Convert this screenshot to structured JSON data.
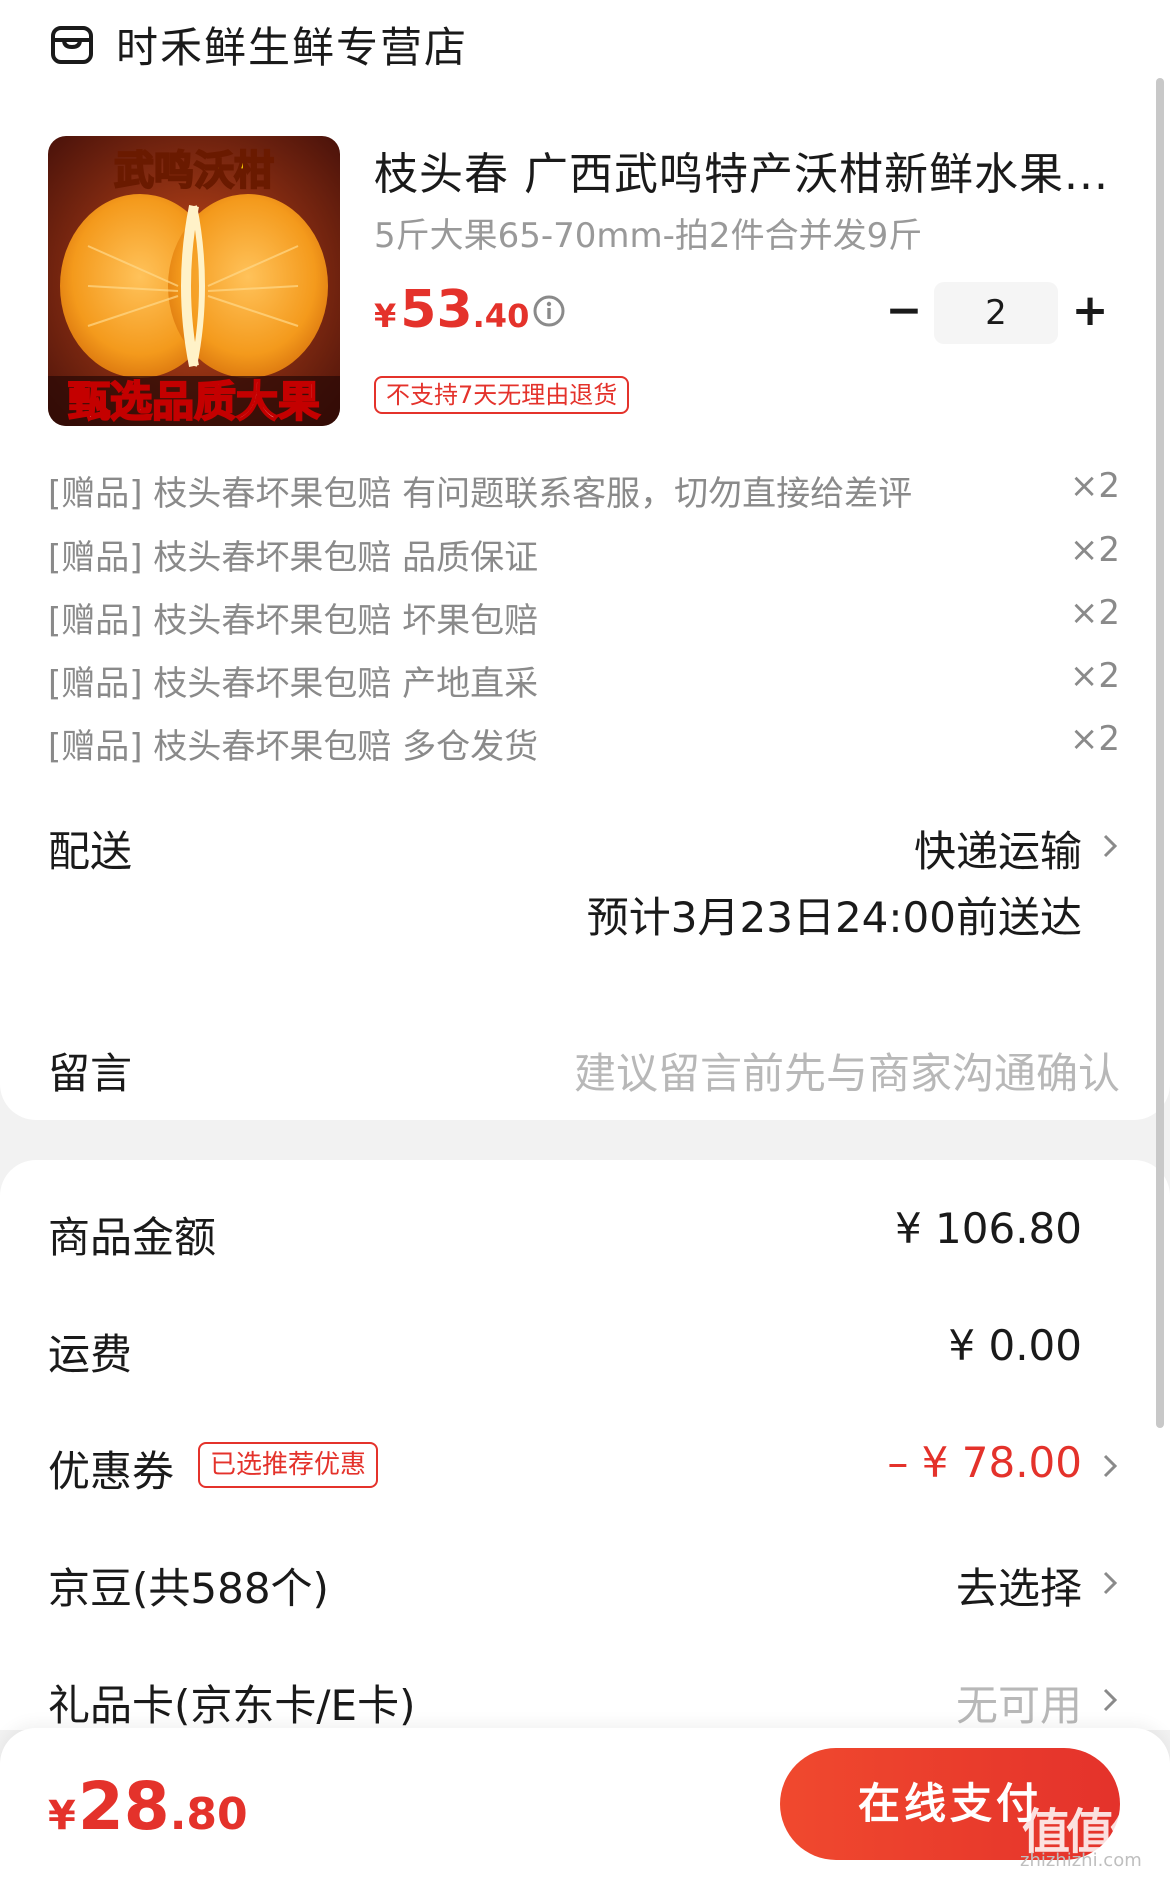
{
  "store": {
    "name": "时禾鲜生鲜专营店",
    "icon": "store-icon"
  },
  "product": {
    "image_text_top": "武鸣沃柑",
    "image_text_bottom": "甄选品质大果",
    "title": "枝头春 广西武鸣特产沃柑新鲜水果...",
    "spec": "5斤大果65-70mm-拍2件合并发9斤",
    "price_symbol": "¥",
    "price_int": "53",
    "price_dec": ".40",
    "quantity": "2",
    "minus_label": "−",
    "plus_label": "+",
    "return_tag": "不支持7天无理由退货"
  },
  "gifts": [
    {
      "text": "[赠品] 枝头春坏果包赔 有问题联系客服，切勿直接给差评",
      "qty": "×2"
    },
    {
      "text": "[赠品] 枝头春坏果包赔 品质保证",
      "qty": "×2"
    },
    {
      "text": "[赠品] 枝头春坏果包赔 坏果包赔",
      "qty": "×2"
    },
    {
      "text": "[赠品] 枝头春坏果包赔 产地直采",
      "qty": "×2"
    },
    {
      "text": "[赠品] 枝头春坏果包赔 多仓发货",
      "qty": "×2"
    }
  ],
  "delivery": {
    "label": "配送",
    "method": "快递运输",
    "eta": "预计3月23日24:00前送达"
  },
  "message": {
    "label": "留言",
    "placeholder": "建议留言前先与商家沟通确认"
  },
  "summary": {
    "goods_label": "商品金额",
    "goods_value": "¥ 106.80",
    "shipping_label": "运费",
    "shipping_value": "¥ 0.00",
    "coupon_label": "优惠券",
    "coupon_tag": "已选推荐优惠",
    "coupon_value": "– ¥ 78.00",
    "beans_label": "京豆(共588个)",
    "beans_value": "去选择",
    "giftcard_label": "礼品卡(京东卡/E卡)",
    "giftcard_value": "无可用"
  },
  "footer": {
    "total_symbol": "¥",
    "total_int": "28",
    "total_dec": ".80",
    "pay_label": "在线支付",
    "watermark": "值值值",
    "watermark_url": "zhizhizhi.com"
  },
  "colors": {
    "accent": "#e4322b",
    "muted": "#999999",
    "hint": "#b8b8b8"
  }
}
